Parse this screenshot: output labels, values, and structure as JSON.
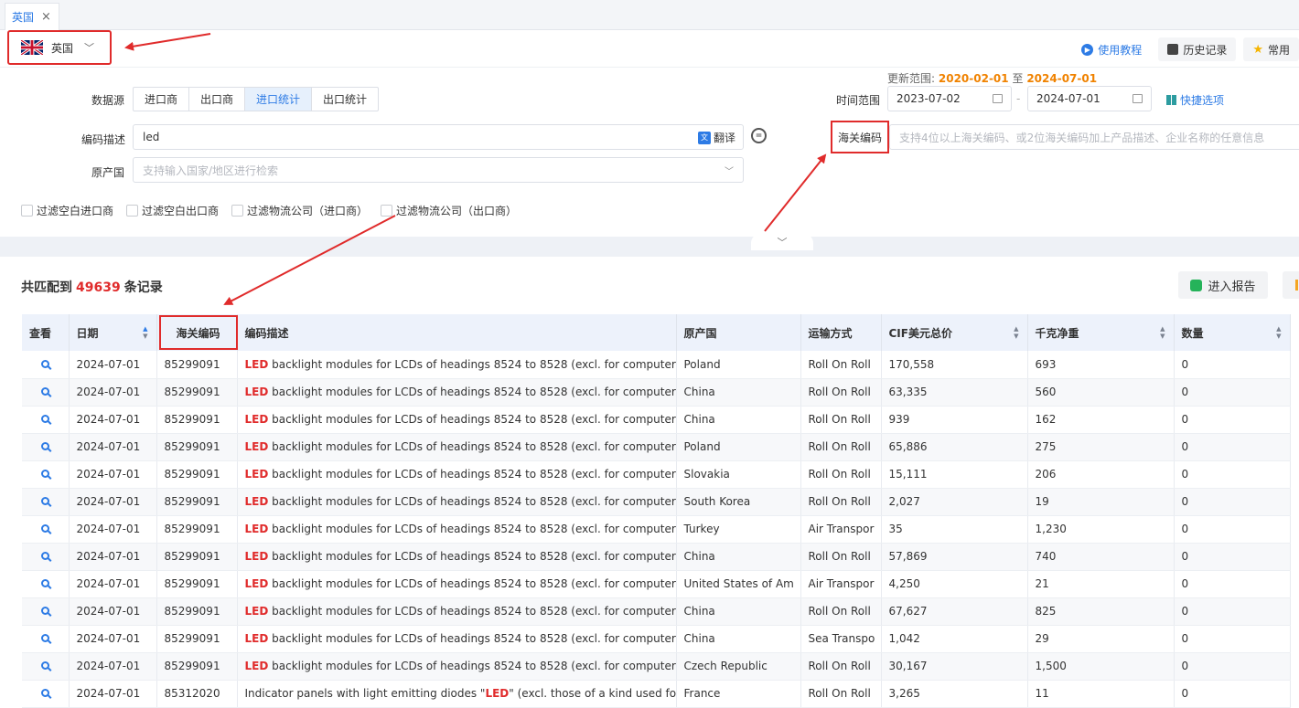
{
  "tab": {
    "label": "英国",
    "close": "×"
  },
  "country": {
    "name": "英国",
    "flag": "uk-flag-icon"
  },
  "top_actions": {
    "tutorial": "使用教程",
    "history": "历史记录",
    "common": "常用"
  },
  "form": {
    "datasource_label": "数据源",
    "datasource_options": [
      "进口商",
      "出口商",
      "进口统计",
      "出口统计"
    ],
    "datasource_active": "进口统计",
    "desc_label": "编码描述",
    "desc_value": "led",
    "translate": "翻译",
    "origin_label": "原产国",
    "origin_placeholder": "支持输入国家/地区进行检索",
    "update_prefix": "更新范围:",
    "update_start": "2020-02-01",
    "update_mid": "至",
    "update_end": "2024-07-01",
    "time_label": "时间范围",
    "date_from": "2023-07-02",
    "date_sep": "-",
    "date_to": "2024-07-01",
    "quick": "快捷选项",
    "hscode_label": "海关编码",
    "hscode_placeholder": "支持4位以上海关编码、或2位海关编码加上产品描述、企业名称的任意信息",
    "filters": [
      "过滤空白进口商",
      "过滤空白出口商",
      "过滤物流公司（进口商）",
      "过滤物流公司（出口商）"
    ]
  },
  "results": {
    "prefix": "共匹配到",
    "count": "49639",
    "suffix": "条记录",
    "report": "进入报告",
    "columns": [
      "查看",
      "日期",
      "海关编码",
      "编码描述",
      "原产国",
      "运输方式",
      "CIF美元总价",
      "千克净重",
      "数量"
    ],
    "rows": [
      {
        "date": "2024-07-01",
        "hs": "85299091",
        "led": "LED",
        "desc": " backlight modules for LCDs of headings 8524 to 8528 (excl. for computer m",
        "origin": "Poland",
        "transport": "Roll On Roll",
        "cif": "170,558",
        "kg": "693",
        "qty": "0"
      },
      {
        "date": "2024-07-01",
        "hs": "85299091",
        "led": "LED",
        "desc": " backlight modules for LCDs of headings 8524 to 8528 (excl. for computer m",
        "origin": "China",
        "transport": "Roll On Roll",
        "cif": "63,335",
        "kg": "560",
        "qty": "0"
      },
      {
        "date": "2024-07-01",
        "hs": "85299091",
        "led": "LED",
        "desc": " backlight modules for LCDs of headings 8524 to 8528 (excl. for computer m",
        "origin": "China",
        "transport": "Roll On Roll",
        "cif": "939",
        "kg": "162",
        "qty": "0"
      },
      {
        "date": "2024-07-01",
        "hs": "85299091",
        "led": "LED",
        "desc": " backlight modules for LCDs of headings 8524 to 8528 (excl. for computer m",
        "origin": "Poland",
        "transport": "Roll On Roll",
        "cif": "65,886",
        "kg": "275",
        "qty": "0"
      },
      {
        "date": "2024-07-01",
        "hs": "85299091",
        "led": "LED",
        "desc": " backlight modules for LCDs of headings 8524 to 8528 (excl. for computer m",
        "origin": "Slovakia",
        "transport": "Roll On Roll",
        "cif": "15,111",
        "kg": "206",
        "qty": "0"
      },
      {
        "date": "2024-07-01",
        "hs": "85299091",
        "led": "LED",
        "desc": " backlight modules for LCDs of headings 8524 to 8528 (excl. for computer m",
        "origin": "South Korea",
        "transport": "Roll On Roll",
        "cif": "2,027",
        "kg": "19",
        "qty": "0"
      },
      {
        "date": "2024-07-01",
        "hs": "85299091",
        "led": "LED",
        "desc": " backlight modules for LCDs of headings 8524 to 8528 (excl. for computer m",
        "origin": "Turkey",
        "transport": "Air Transpor",
        "cif": "35",
        "kg": "1,230",
        "qty": "0"
      },
      {
        "date": "2024-07-01",
        "hs": "85299091",
        "led": "LED",
        "desc": " backlight modules for LCDs of headings 8524 to 8528 (excl. for computer m",
        "origin": "China",
        "transport": "Roll On Roll",
        "cif": "57,869",
        "kg": "740",
        "qty": "0"
      },
      {
        "date": "2024-07-01",
        "hs": "85299091",
        "led": "LED",
        "desc": " backlight modules for LCDs of headings 8524 to 8528 (excl. for computer m",
        "origin": "United States of Am",
        "transport": "Air Transpor",
        "cif": "4,250",
        "kg": "21",
        "qty": "0"
      },
      {
        "date": "2024-07-01",
        "hs": "85299091",
        "led": "LED",
        "desc": " backlight modules for LCDs of headings 8524 to 8528 (excl. for computer m",
        "origin": "China",
        "transport": "Roll On Roll",
        "cif": "67,627",
        "kg": "825",
        "qty": "0"
      },
      {
        "date": "2024-07-01",
        "hs": "85299091",
        "led": "LED",
        "desc": " backlight modules for LCDs of headings 8524 to 8528 (excl. for computer m",
        "origin": "China",
        "transport": "Sea Transpo",
        "cif": "1,042",
        "kg": "29",
        "qty": "0"
      },
      {
        "date": "2024-07-01",
        "hs": "85299091",
        "led": "LED",
        "desc": " backlight modules for LCDs of headings 8524 to 8528 (excl. for computer m",
        "origin": "Czech Republic",
        "transport": "Roll On Roll",
        "cif": "30,167",
        "kg": "1,500",
        "qty": "0"
      },
      {
        "date": "2024-07-01",
        "hs": "85312020",
        "pre": "Indicator panels with light emitting diodes \"",
        "led": "LED",
        "desc": "\" (excl. those of a kind used for",
        "origin": "France",
        "transport": "Roll On Roll",
        "cif": "3,265",
        "kg": "11",
        "qty": "0"
      }
    ]
  },
  "colors": {
    "accent": "#2d7be5",
    "highlight": "#e02b2b",
    "orange": "#f08200"
  }
}
